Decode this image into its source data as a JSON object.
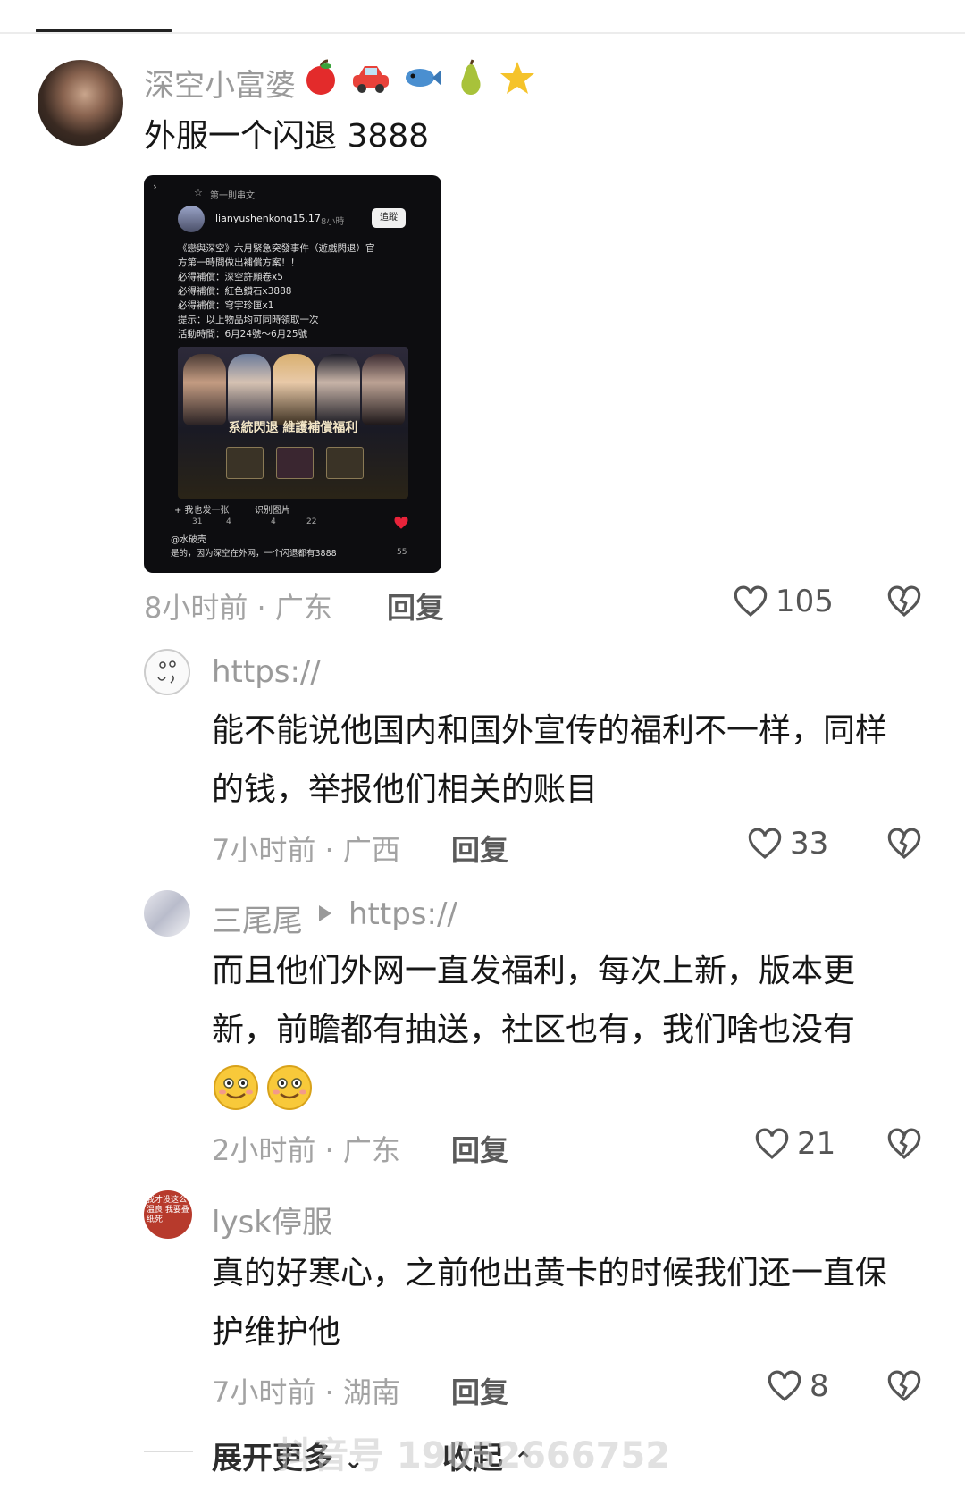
{
  "comments": [
    {
      "username": "深空小富婆",
      "badges": [
        "apple-emoji",
        "car-emoji",
        "fish-emoji",
        "pear-emoji",
        "star-emoji"
      ],
      "text": "外服一个闪退 3888",
      "time_location": "8小时前 · 广东",
      "reply_label": "回复",
      "likes": "105",
      "attachment": {
        "rank_label": "第一則串文",
        "author": "lianyushenkong15.17",
        "author_time": "8小時",
        "follow_label": "追蹤",
        "lines": [
          "《戀與深空》六月緊急突發事件（遊戲閃退）官",
          "方第一時間做出補償方案！！",
          "必得補償：深空許願卷x5",
          "必得補償：紅色鑽石x3888",
          "必得補償：穹宇珍匣x1",
          "提示：以上物品均可同時領取一次",
          "活動時間：6月24號～6月25號"
        ],
        "poster_title": "系統閃退 維護補償福利",
        "actions": [
          "+ 我也发一张",
          "识别图片"
        ],
        "stats": [
          "31",
          "4",
          "4",
          "22"
        ],
        "reply_user": "@水破壳",
        "reply_text": "是的，因为深空在外网，一个闪退都有3888",
        "reply_likes": "55"
      }
    },
    {
      "username": "https://",
      "text": "能不能说他国内和国外宣传的福利不一样，同样的钱，举报他们相关的账目",
      "time_location": "7小时前 · 广西",
      "reply_label": "回复",
      "likes": "33"
    },
    {
      "username": "三尾尾",
      "reply_to": "https://",
      "text": "而且他们外网一直发福利，每次上新，版本更新，前瞻都有抽送，社区也有，我们啥也没有",
      "emojis": [
        "smile-emoji",
        "smile-emoji"
      ],
      "time_location": "2小时前 · 广东",
      "reply_label": "回复",
      "likes": "21"
    },
    {
      "username": "lysk停服",
      "avatar_text": "我才没这么温良 我要叠纸死",
      "text": "真的好寒心，之前他出黄卡的时候我们还一直保护维护他",
      "time_location": "7小时前 · 湖南",
      "reply_label": "回复",
      "likes": "8"
    }
  ],
  "footer": {
    "expand_label": "展开更多",
    "collapse_label": "收起",
    "watermark": "抖音号 19052666752"
  },
  "colors": {
    "text": "#161616",
    "meta": "#a3a3a3",
    "name": "#9a9a9a",
    "accent_red": "#e8233a"
  }
}
